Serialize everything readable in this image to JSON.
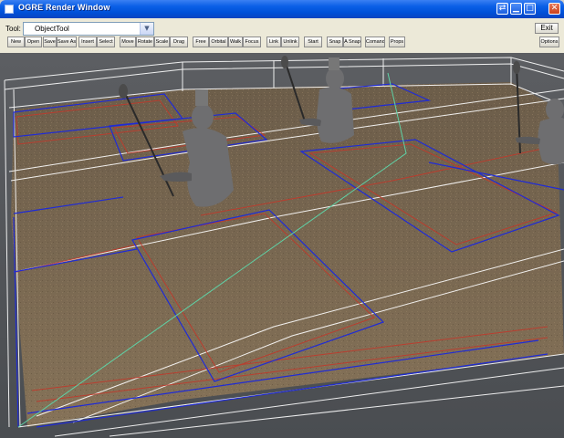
{
  "window": {
    "title": "OGRE Render Window"
  },
  "toolbar": {
    "tool_label": "Tool:",
    "tool_value": "ObjectTool",
    "exit_label": "Exit",
    "options_label": "Options",
    "buttons": [
      "New",
      "Open",
      "Save",
      "Save As",
      "Insert",
      "Select",
      "Move",
      "Rotate",
      "Scale",
      "Drag",
      "Free",
      "Orbital",
      "Walk",
      "Focus",
      "Link",
      "Unlink",
      "Start",
      "Snap",
      "A Snap",
      "Comand",
      "Props"
    ]
  },
  "titlebar_buttons": [
    "restore-icon",
    "minimize-icon",
    "maximize-icon",
    "close-icon"
  ],
  "colors": {
    "floor": "#776650",
    "wire_white": "#ffffff",
    "wire_red": "#c0392b",
    "wire_blue": "#1f2bd6",
    "line_green": "#5fd2a6",
    "statue": "#6e6e70"
  }
}
